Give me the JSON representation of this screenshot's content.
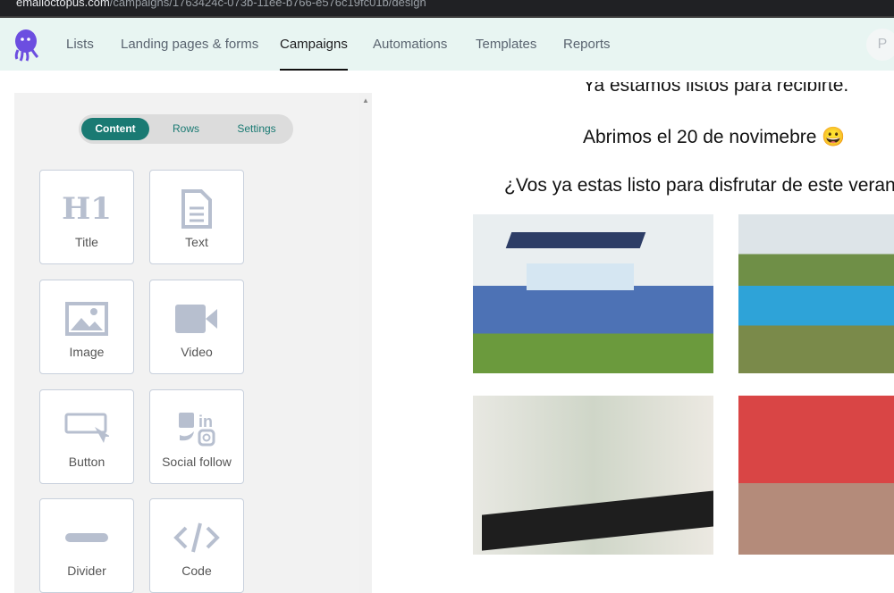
{
  "browser": {
    "url_domain": "emailoctopus.com",
    "url_path": "/campaigns/1763424c-073b-11ee-b766-e576c19fc01b/design"
  },
  "nav": {
    "items": [
      {
        "label": "Lists"
      },
      {
        "label": "Landing pages & forms"
      },
      {
        "label": "Campaigns"
      },
      {
        "label": "Automations"
      },
      {
        "label": "Templates"
      },
      {
        "label": "Reports"
      }
    ],
    "active": "Campaigns",
    "avatar": "P"
  },
  "panel": {
    "tabs": [
      {
        "label": "Content"
      },
      {
        "label": "Rows"
      },
      {
        "label": "Settings"
      }
    ],
    "active_tab": "Content",
    "blocks": [
      {
        "label": "Title",
        "icon": "h1-icon"
      },
      {
        "label": "Text",
        "icon": "document-icon"
      },
      {
        "label": "Image",
        "icon": "image-icon"
      },
      {
        "label": "Video",
        "icon": "video-icon"
      },
      {
        "label": "Button",
        "icon": "button-cursor-icon"
      },
      {
        "label": "Social follow",
        "icon": "social-icon"
      },
      {
        "label": "Divider",
        "icon": "divider-icon"
      },
      {
        "label": "Code",
        "icon": "code-icon"
      }
    ]
  },
  "email": {
    "line1": "Ya estamos listos para recibirte.",
    "line2": "Abrimos el 20 de novimebre 😀",
    "line3": "¿Vos ya estas listo para disfrutar de este verano?"
  },
  "colors": {
    "accent": "#1a7a73",
    "logo": "#6c4ee0",
    "nav_bg": "#e8f5f2"
  }
}
